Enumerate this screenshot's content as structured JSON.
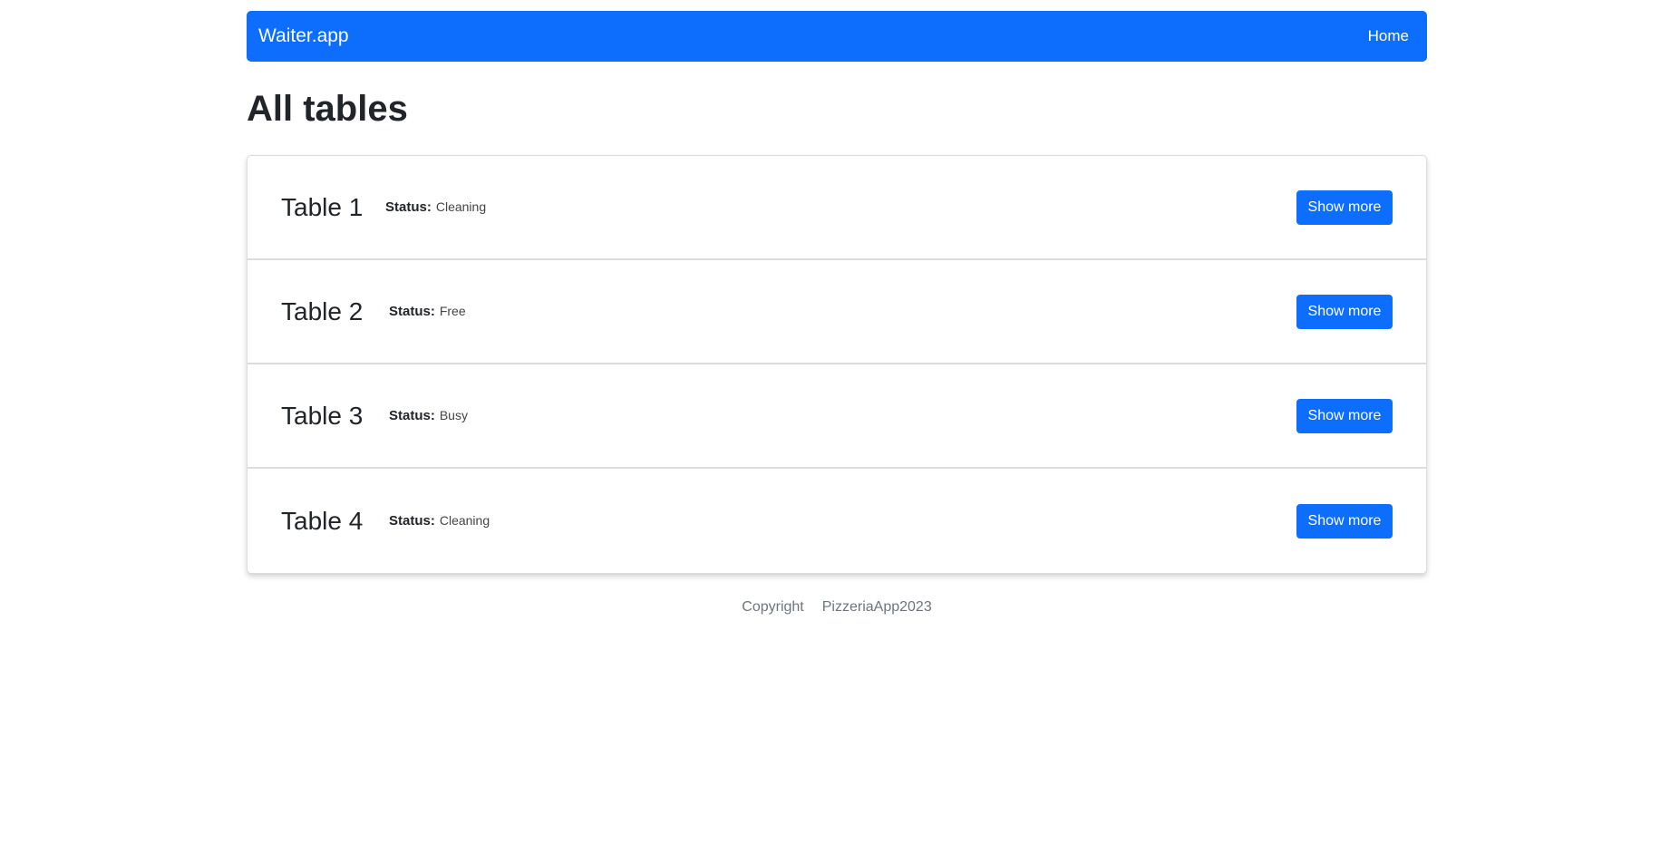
{
  "navbar": {
    "brand": "Waiter.app",
    "links": [
      {
        "label": "Home"
      }
    ]
  },
  "page": {
    "title": "All tables"
  },
  "tables": [
    {
      "name": "Table 1",
      "status_label": "Status:",
      "status": "Cleaning",
      "button": "Show more"
    },
    {
      "name": "Table 2",
      "status_label": "Status:",
      "status": "Free",
      "button": "Show more"
    },
    {
      "name": "Table 3",
      "status_label": "Status:",
      "status": "Busy",
      "button": "Show more"
    },
    {
      "name": "Table 4",
      "status_label": "Status:",
      "status": "Cleaning",
      "button": "Show more"
    }
  ],
  "footer": {
    "copyright": "Copyright",
    "owner": "PizzeriaApp2023"
  },
  "colors": {
    "primary": "#0d6efd",
    "text": "#212529",
    "muted": "#6c757d"
  }
}
